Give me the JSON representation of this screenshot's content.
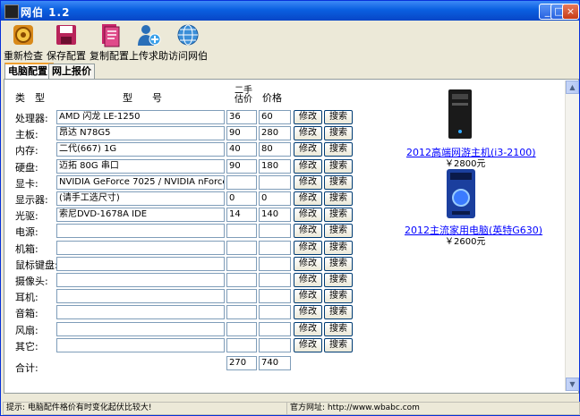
{
  "window": {
    "title": "网伯 1.2"
  },
  "toolbar": [
    {
      "label": "重新检查",
      "icon": "gear-icon"
    },
    {
      "label": "保存配置",
      "icon": "floppy-icon"
    },
    {
      "label": "复制配置",
      "icon": "copy-icon"
    },
    {
      "label": "上传求助",
      "icon": "user-add-icon"
    },
    {
      "label": "访问网伯",
      "icon": "globe-icon"
    }
  ],
  "tabs": [
    {
      "label": "电脑配置",
      "active": true
    },
    {
      "label": "网上报价",
      "active": false
    }
  ],
  "table": {
    "headers": {
      "category": "类　型",
      "model": "型　　号",
      "used_price": "二手估价",
      "price": "价格"
    },
    "rows": [
      {
        "label": "处理器:",
        "model": "AMD 闪龙 LE-1250",
        "used": "36",
        "price": "60"
      },
      {
        "label": "主板:",
        "model": "昂达 N78G5",
        "used": "90",
        "price": "280"
      },
      {
        "label": "内存:",
        "model": "二代(667) 1G",
        "used": "40",
        "price": "80"
      },
      {
        "label": "硬盘:",
        "model": "迈拓 80G 串口",
        "used": "90",
        "price": "180"
      },
      {
        "label": "显卡:",
        "model": "NVIDIA GeForce 7025 / NVIDIA nForce",
        "used": "",
        "price": ""
      },
      {
        "label": "显示器:",
        "model": "(请手工选尺寸)",
        "used": "0",
        "price": "0"
      },
      {
        "label": "光驱:",
        "model": "索尼DVD-1678A IDE",
        "used": "14",
        "price": "140"
      },
      {
        "label": "电源:",
        "model": "",
        "used": "",
        "price": ""
      },
      {
        "label": "机箱:",
        "model": "",
        "used": "",
        "price": ""
      },
      {
        "label": "鼠标键盘:",
        "model": "",
        "used": "",
        "price": ""
      },
      {
        "label": "摄像头:",
        "model": "",
        "used": "",
        "price": ""
      },
      {
        "label": "耳机:",
        "model": "",
        "used": "",
        "price": ""
      },
      {
        "label": "音箱:",
        "model": "",
        "used": "",
        "price": ""
      },
      {
        "label": "风扇:",
        "model": "",
        "used": "",
        "price": ""
      },
      {
        "label": "其它:",
        "model": "",
        "used": "",
        "price": ""
      }
    ],
    "edit_label": "修改",
    "search_label": "搜索",
    "total_label": "合计:",
    "total_used": "270",
    "total_price": "740"
  },
  "ads": [
    {
      "title": "2012高端网游主机(i3-2100)",
      "price": "￥2800元"
    },
    {
      "title": "2012主流家用电脑(英特G630)",
      "price": "￥2600元"
    }
  ],
  "status": {
    "tip": "提示: 电脑配件格价有时变化起伏比较大!",
    "site": "官方网址: http://www.wbabc.com"
  }
}
